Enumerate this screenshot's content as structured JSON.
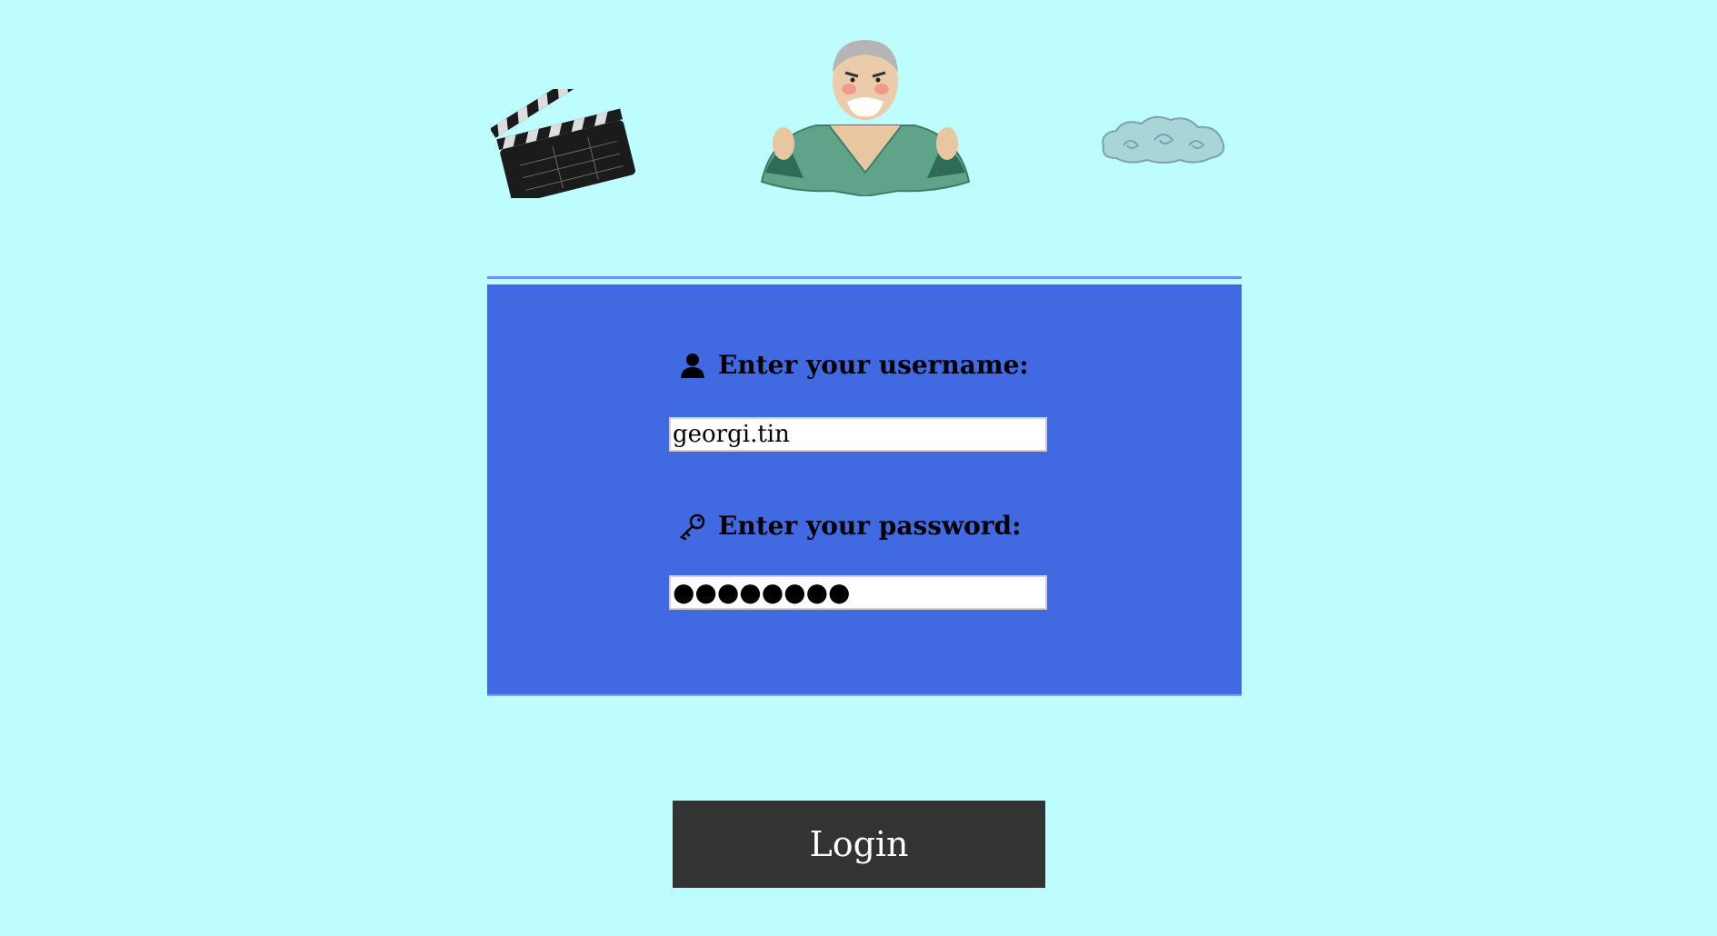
{
  "header": {
    "icons": [
      "clapperboard-icon",
      "old-monk-illustration",
      "cloud-icon"
    ]
  },
  "login_form": {
    "username_label": "Enter your username:",
    "username_value": "georgi.tin",
    "password_label": "Enter your password:",
    "password_value": "●●●●●●●●",
    "username_icon": "user-icon",
    "password_icon": "key-icon"
  },
  "actions": {
    "login_label": "Login"
  },
  "colors": {
    "background": "#bdfdfd",
    "panel": "#4169e1",
    "button": "#333333"
  }
}
